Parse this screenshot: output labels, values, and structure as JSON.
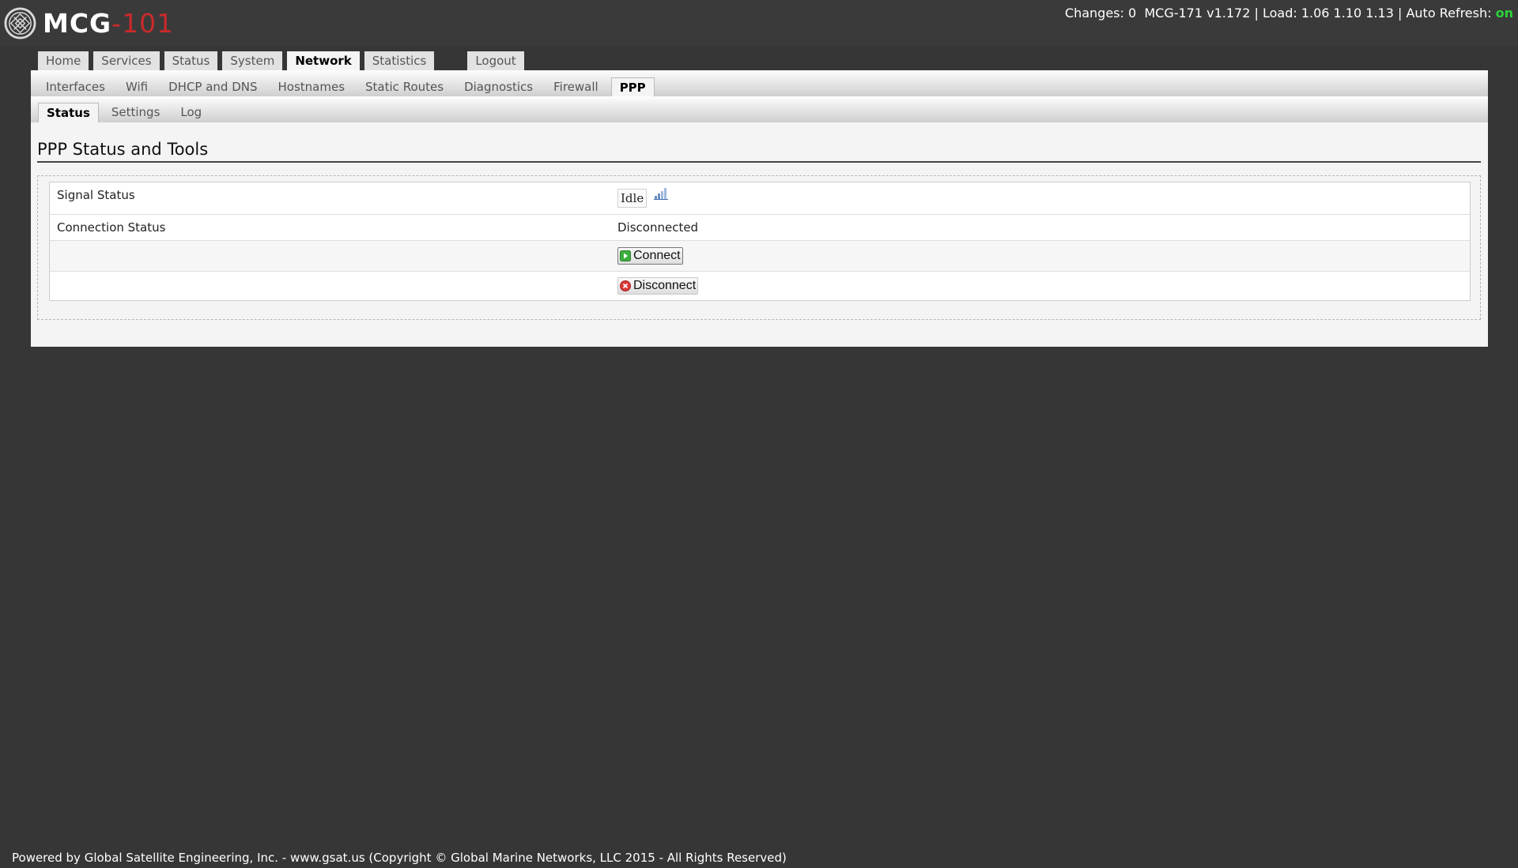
{
  "header": {
    "logo_main": "MCG",
    "logo_sep": "-",
    "logo_num": "101",
    "changes_label": "Changes:",
    "changes_value": "0",
    "device": "MCG-171 v1.172",
    "load_label": "Load:",
    "load_value": "1.06 1.10 1.13",
    "auto_refresh_label": "Auto Refresh:",
    "auto_refresh_value": "on",
    "separator": "|",
    "colors": {
      "background": "#3a3a3a",
      "logo_accent": "#c92a2a",
      "auto_refresh_on": "#2ad43a"
    }
  },
  "top_tabs": [
    {
      "label": "Home",
      "active": false
    },
    {
      "label": "Services",
      "active": false
    },
    {
      "label": "Status",
      "active": false
    },
    {
      "label": "System",
      "active": false
    },
    {
      "label": "Network",
      "active": true
    },
    {
      "label": "Statistics",
      "active": false
    }
  ],
  "logout_label": "Logout",
  "sub_tabs": [
    {
      "label": "Interfaces",
      "active": false
    },
    {
      "label": "Wifi",
      "active": false
    },
    {
      "label": "DHCP and DNS",
      "active": false
    },
    {
      "label": "Hostnames",
      "active": false
    },
    {
      "label": "Static Routes",
      "active": false
    },
    {
      "label": "Diagnostics",
      "active": false
    },
    {
      "label": "Firewall",
      "active": false
    },
    {
      "label": "PPP",
      "active": true
    }
  ],
  "sub2_tabs": [
    {
      "label": "Status",
      "active": true
    },
    {
      "label": "Settings",
      "active": false
    },
    {
      "label": "Log",
      "active": false
    }
  ],
  "page": {
    "title": "PPP Status and Tools",
    "rows": {
      "signal_status_label": "Signal Status",
      "signal_status_value": "Idle",
      "signal_icon": "signal-bars-icon",
      "connection_status_label": "Connection Status",
      "connection_status_value": "Disconnected"
    },
    "connect_button": {
      "label": "Connect",
      "icon": "play-icon"
    },
    "disconnect_button": {
      "label": "Disconnect",
      "icon": "close-circle-icon"
    }
  },
  "footer": {
    "text": "Powered by Global Satellite Engineering, Inc. - www.gsat.us (Copyright © Global Marine Networks, LLC 2015 - All Rights Reserved)"
  }
}
